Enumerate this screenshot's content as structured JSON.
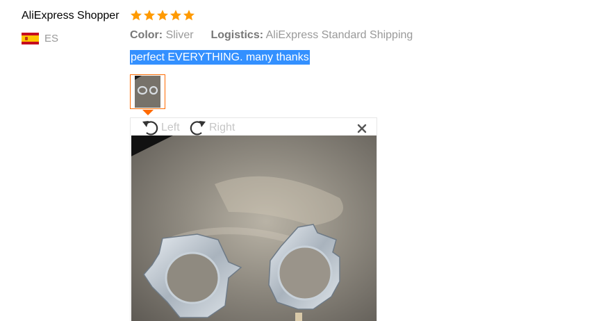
{
  "reviewer": {
    "name": "AliExpress Shopper",
    "country_code": "ES",
    "flag_icon": "spain-flag-icon"
  },
  "rating": {
    "stars": 5,
    "max": 5,
    "color": "#ff9a00"
  },
  "order_info": {
    "color_label": "Color:",
    "color_value": "Sliver",
    "logistics_label": "Logistics:",
    "logistics_value": "AliExpress Standard Shipping"
  },
  "feedback": {
    "text": "perfect EVERYTHING. many thanks",
    "highlight_color": "#3390ff"
  },
  "photos": {
    "count": 1,
    "active_border_color": "#ff6a00"
  },
  "viewer": {
    "rotate_left_label": "Left",
    "rotate_right_label": "Right",
    "rotate_left_icon": "rotate-left-icon",
    "rotate_right_icon": "rotate-right-icon",
    "close_icon": "close-icon"
  }
}
